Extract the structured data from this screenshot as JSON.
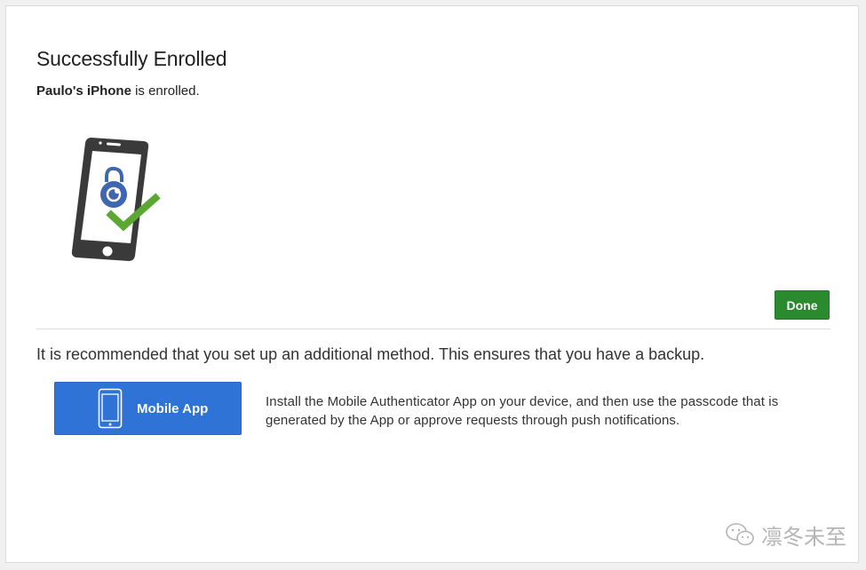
{
  "enrollment": {
    "title": "Successfully Enrolled",
    "device_name": "Paulo's iPhone",
    "enrolled_suffix": " is enrolled."
  },
  "actions": {
    "done_label": "Done"
  },
  "recommendation": {
    "text": "It is recommended that you set up an additional method. This ensures that you have a backup."
  },
  "methods": [
    {
      "label": "Mobile App",
      "icon": "smartphone-icon",
      "description": "Install the Mobile Authenticator App on your device, and then use the passcode that is generated by the App or approve requests through push notifications."
    }
  ],
  "watermark": {
    "text": "凛冬未至",
    "icon": "wechat-icon"
  },
  "colors": {
    "done_green": "#2a8a2e",
    "method_blue": "#2f73d6",
    "check_green": "#5aa832",
    "lock_blue": "#3f66b0",
    "phone_body": "#3a3a3a"
  }
}
